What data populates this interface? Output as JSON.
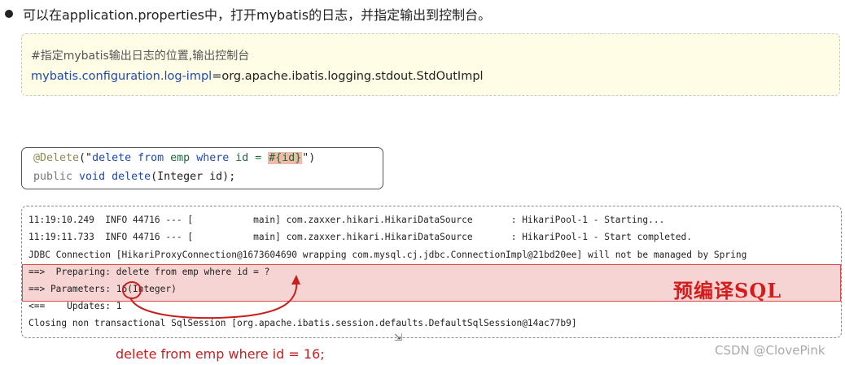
{
  "intro": {
    "text": "可以在application.properties中，打开mybatis的日志，并指定输出到控制台。"
  },
  "config": {
    "comment": "#指定mybatis输出日志的位置,输出控制台",
    "key": "mybatis.configuration.log-impl",
    "equals": "=",
    "value": "org.apache.ibatis.logging.stdout.StdOutImpl"
  },
  "code": {
    "annotation": "@Delete",
    "open": "(\"",
    "sql_kw1": "delete",
    "sp1": " ",
    "sql_kw2": "from",
    "sql_mid": " emp ",
    "sql_kw3": "where",
    "sql_mid2": " id = ",
    "placeholder": "#{id}",
    "close": "\")",
    "line2_public": "public ",
    "line2_void": "void ",
    "line2_name": "delete",
    "line2_rest": "(Integer id);"
  },
  "log": {
    "lines": [
      "11:19:10.249  INFO 44716 --- [           main] com.zaxxer.hikari.HikariDataSource       : HikariPool-1 - Starting...",
      "11:19:11.733  INFO 44716 --- [           main] com.zaxxer.hikari.HikariDataSource       : HikariPool-1 - Start completed.",
      "JDBC Connection [HikariProxyConnection@1673604690 wrapping com.mysql.cj.jdbc.ConnectionImpl@21bd20ee] will not be managed by Spring",
      "==>  Preparing: delete from emp where id = ?",
      "==> Parameters: 16(Integer)",
      "<==    Updates: 1",
      "Closing non transactional SqlSession [org.apache.ibatis.session.defaults.DefaultSqlSession@14ac77b9]"
    ],
    "highlight_label": "预编译SQL"
  },
  "result": {
    "text": "delete  from  emp  where  id = 16;"
  },
  "watermark": {
    "text": "CSDN @ClovePink"
  },
  "colors": {
    "accent_red": "#c81e1e",
    "config_bg": "#fffde6",
    "highlight_bg": "#f7d4d4"
  }
}
